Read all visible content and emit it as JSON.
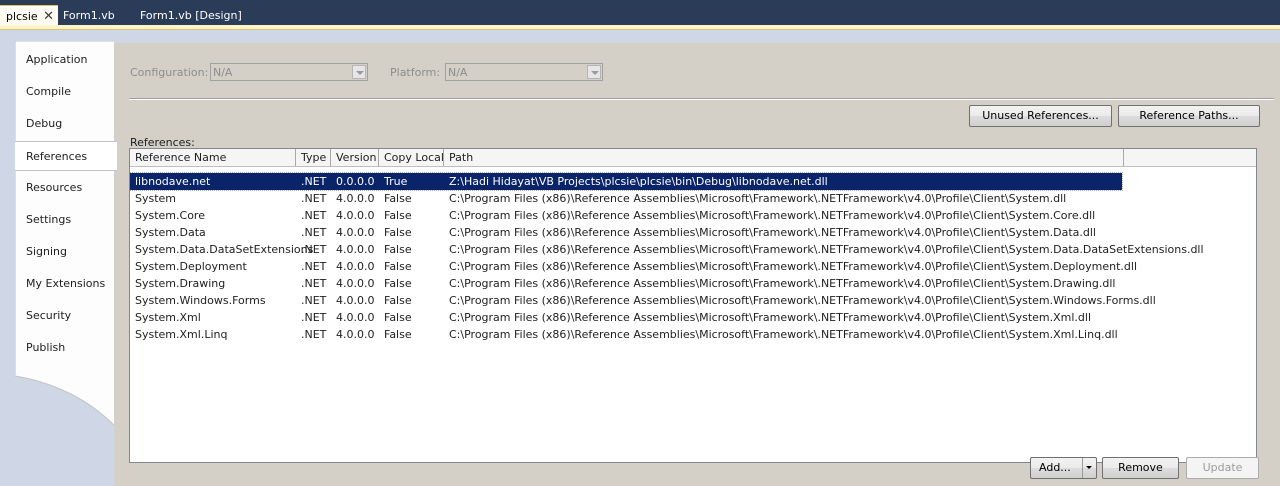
{
  "doc_tabs": [
    {
      "label": "plcsie",
      "active": true
    },
    {
      "label": "Form1.vb",
      "active": false
    },
    {
      "label": "Form1.vb [Design]",
      "active": false
    }
  ],
  "close_glyph": "✕",
  "sidebar": {
    "items": [
      {
        "label": "Application"
      },
      {
        "label": "Compile"
      },
      {
        "label": "Debug"
      },
      {
        "label": "References",
        "selected": true
      },
      {
        "label": "Resources"
      },
      {
        "label": "Settings"
      },
      {
        "label": "Signing"
      },
      {
        "label": "My Extensions"
      },
      {
        "label": "Security"
      },
      {
        "label": "Publish"
      }
    ]
  },
  "config": {
    "configuration_label": "Configuration:",
    "configuration_value": "N/A",
    "platform_label": "Platform:",
    "platform_value": "N/A"
  },
  "buttons": {
    "unused_refs": "Unused References...",
    "ref_paths": "Reference Paths...",
    "add": "Add...",
    "remove": "Remove",
    "update": "Update"
  },
  "references": {
    "label": "References:",
    "columns": [
      "Reference Name",
      "Type",
      "Version",
      "Copy Local",
      "Path"
    ],
    "rows": [
      [
        "libnodave.net",
        ".NET",
        "0.0.0.0",
        "True",
        "Z:\\Hadi Hidayat\\VB Projects\\plcsie\\plcsie\\bin\\Debug\\libnodave.net.dll"
      ],
      [
        "System",
        ".NET",
        "4.0.0.0",
        "False",
        "C:\\Program Files (x86)\\Reference Assemblies\\Microsoft\\Framework\\.NETFramework\\v4.0\\Profile\\Client\\System.dll"
      ],
      [
        "System.Core",
        ".NET",
        "4.0.0.0",
        "False",
        "C:\\Program Files (x86)\\Reference Assemblies\\Microsoft\\Framework\\.NETFramework\\v4.0\\Profile\\Client\\System.Core.dll"
      ],
      [
        "System.Data",
        ".NET",
        "4.0.0.0",
        "False",
        "C:\\Program Files (x86)\\Reference Assemblies\\Microsoft\\Framework\\.NETFramework\\v4.0\\Profile\\Client\\System.Data.dll"
      ],
      [
        "System.Data.DataSetExtensions",
        ".NET",
        "4.0.0.0",
        "False",
        "C:\\Program Files (x86)\\Reference Assemblies\\Microsoft\\Framework\\.NETFramework\\v4.0\\Profile\\Client\\System.Data.DataSetExtensions.dll"
      ],
      [
        "System.Deployment",
        ".NET",
        "4.0.0.0",
        "False",
        "C:\\Program Files (x86)\\Reference Assemblies\\Microsoft\\Framework\\.NETFramework\\v4.0\\Profile\\Client\\System.Deployment.dll"
      ],
      [
        "System.Drawing",
        ".NET",
        "4.0.0.0",
        "False",
        "C:\\Program Files (x86)\\Reference Assemblies\\Microsoft\\Framework\\.NETFramework\\v4.0\\Profile\\Client\\System.Drawing.dll"
      ],
      [
        "System.Windows.Forms",
        ".NET",
        "4.0.0.0",
        "False",
        "C:\\Program Files (x86)\\Reference Assemblies\\Microsoft\\Framework\\.NETFramework\\v4.0\\Profile\\Client\\System.Windows.Forms.dll"
      ],
      [
        "System.Xml",
        ".NET",
        "4.0.0.0",
        "False",
        "C:\\Program Files (x86)\\Reference Assemblies\\Microsoft\\Framework\\.NETFramework\\v4.0\\Profile\\Client\\System.Xml.dll"
      ],
      [
        "System.Xml.Linq",
        ".NET",
        "4.0.0.0",
        "False",
        "C:\\Program Files (x86)\\Reference Assemblies\\Microsoft\\Framework\\.NETFramework\\v4.0\\Profile\\Client\\System.Xml.Linq.dll"
      ]
    ],
    "selected_index": 0
  },
  "colors": {
    "tabstrip_bg": "#2b3c59",
    "designer_bg": "#cfd6e5",
    "selection": "#0a246a"
  }
}
